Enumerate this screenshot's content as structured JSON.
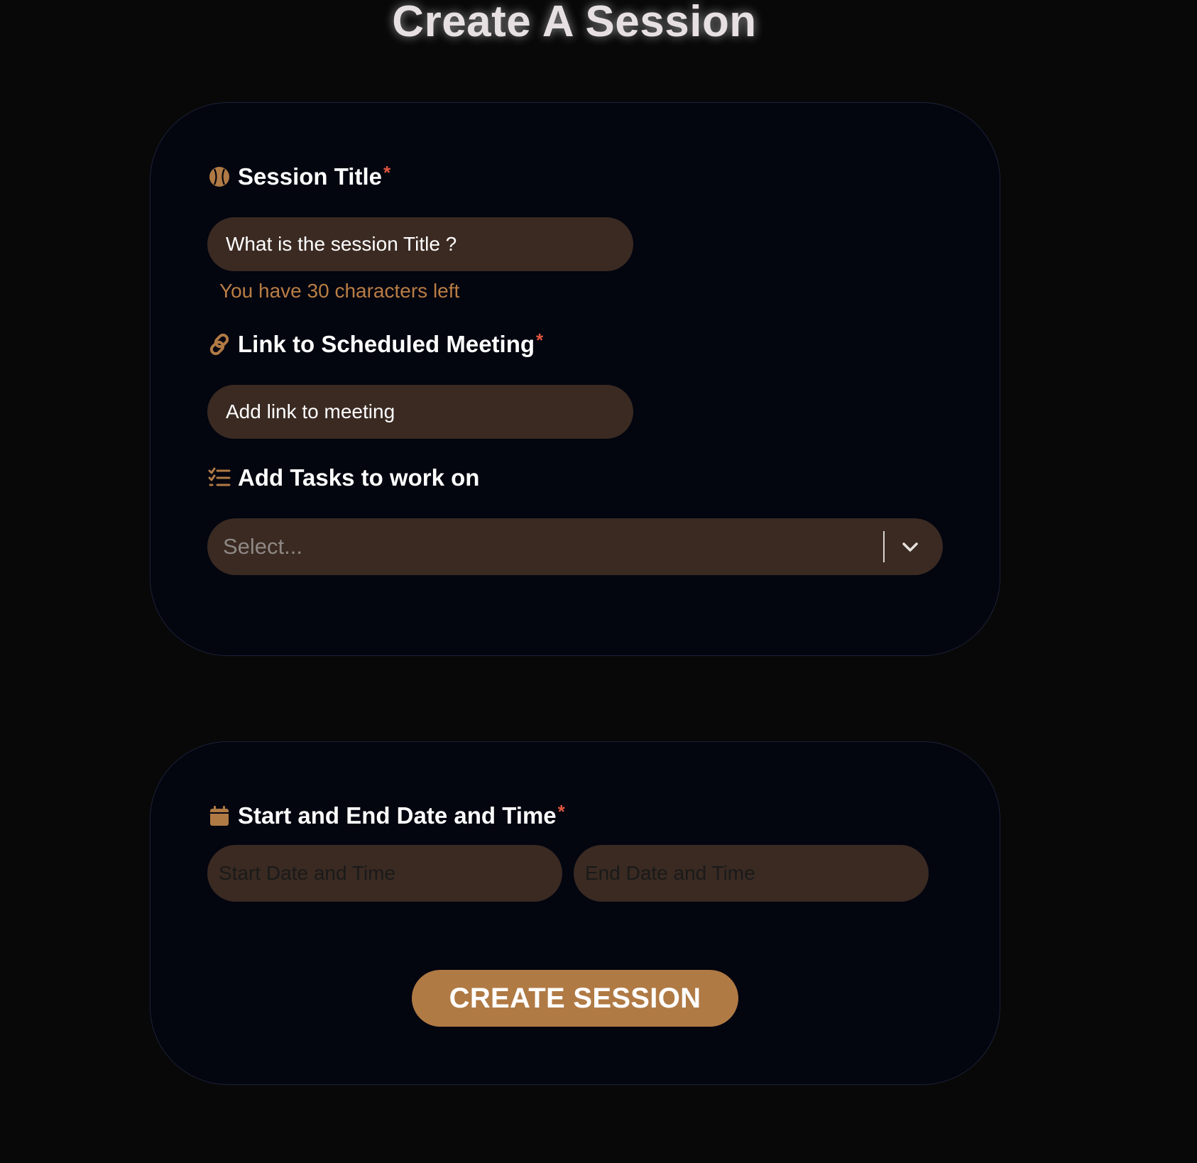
{
  "page": {
    "title": "Create A Session"
  },
  "session_title": {
    "label": "Session Title",
    "required_mark": "*",
    "placeholder": "What is the session Title ?",
    "hint": "You have 30 characters left",
    "icon": "baseball-icon"
  },
  "meeting_link": {
    "label": "Link to Scheduled Meeting",
    "required_mark": "*",
    "placeholder": "Add link to meeting",
    "icon": "link-icon"
  },
  "tasks": {
    "label": "Add Tasks to work on",
    "placeholder": "Select...",
    "icon": "checklist-icon"
  },
  "schedule": {
    "label": "Start and End Date and Time",
    "required_mark": "*",
    "start_placeholder": "Start Date and Time",
    "end_placeholder": "End Date and Time",
    "icon": "calendar-icon"
  },
  "submit": {
    "label": "CREATE SESSION"
  },
  "colors": {
    "background": "#080808",
    "card": "#03050f",
    "input": "#3a2a22",
    "accent": "#b07a45",
    "required": "#e0563f"
  }
}
